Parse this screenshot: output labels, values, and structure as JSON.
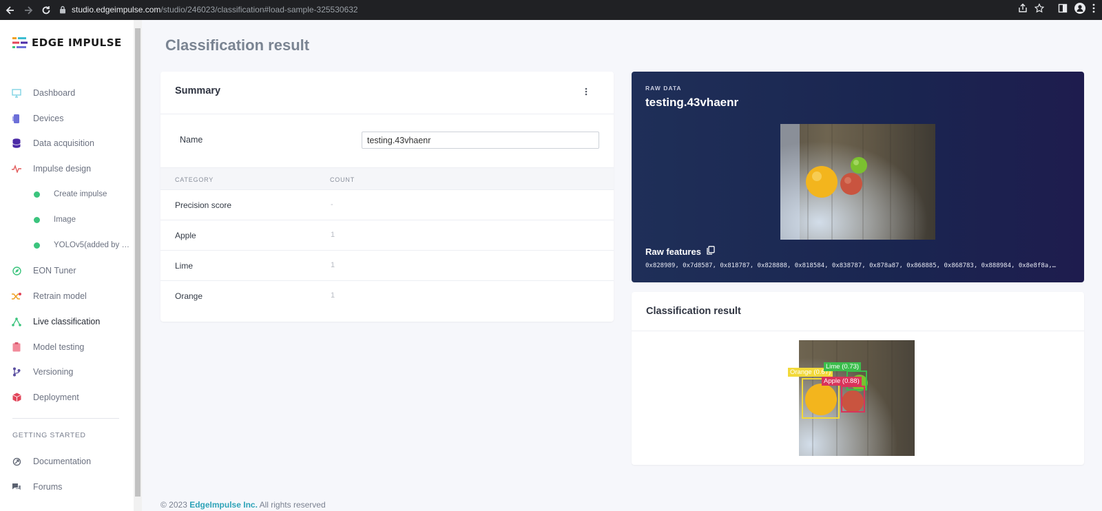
{
  "browser": {
    "url_host": "studio.edgeimpulse.com",
    "url_path": "/studio/246023/classification#load-sample-325530632"
  },
  "sidebar": {
    "logo_text": "EDGE IMPULSE",
    "items": [
      {
        "label": "Dashboard",
        "icon": "monitor-icon",
        "color": "#7fd3e3"
      },
      {
        "label": "Devices",
        "icon": "chip-icon",
        "color": "#6c6fd8"
      },
      {
        "label": "Data acquisition",
        "icon": "database-icon",
        "color": "#4b2aa6"
      },
      {
        "label": "Impulse design",
        "icon": "pulse-icon",
        "color": "#e25b5b"
      },
      {
        "label": "Create impulse",
        "icon": "status-dot-icon",
        "color": "#3bc47d"
      },
      {
        "label": "Image",
        "icon": "status-dot-icon",
        "color": "#3bc47d"
      },
      {
        "label": "YOLOv5(added by S...",
        "icon": "status-dot-icon",
        "color": "#3bc47d"
      },
      {
        "label": "EON Tuner",
        "icon": "compass-icon",
        "color": "#3bc47d"
      },
      {
        "label": "Retrain model",
        "icon": "shuffle-icon",
        "color": "#f0a020"
      },
      {
        "label": "Live classification",
        "icon": "nodes-icon",
        "color": "#3bc47d"
      },
      {
        "label": "Model testing",
        "icon": "clipboard-icon",
        "color": "#f28a9a"
      },
      {
        "label": "Versioning",
        "icon": "branch-icon",
        "color": "#5a4fa0"
      },
      {
        "label": "Deployment",
        "icon": "box-icon",
        "color": "#e2455a"
      }
    ],
    "section_title": "GETTING STARTED",
    "help_items": [
      {
        "label": "Documentation",
        "icon": "docs-icon"
      },
      {
        "label": "Forums",
        "icon": "forum-icon"
      }
    ]
  },
  "main": {
    "page_title": "Classification result",
    "summary": {
      "title": "Summary",
      "name_label": "Name",
      "name_value": "testing.43vhaenr",
      "col_category": "CATEGORY",
      "col_count": "COUNT",
      "rows": [
        {
          "category": "Precision score",
          "count": "-"
        },
        {
          "category": "Apple",
          "count": "1"
        },
        {
          "category": "Lime",
          "count": "1"
        },
        {
          "category": "Orange",
          "count": "1"
        }
      ]
    },
    "raw": {
      "label": "RAW DATA",
      "name": "testing.43vhaenr",
      "features_label": "Raw features",
      "features_values": "0x828989, 0x7d8587, 0x818787, 0x828888, 0x818584, 0x838787, 0x878a87, 0x868885, 0x868783, 0x888984, 0x8e8f8a,…"
    },
    "result": {
      "title": "Classification result",
      "boxes": [
        {
          "label": "Orange (0.67)",
          "color": "#f2d93a"
        },
        {
          "label": "Lime (0.73)",
          "color": "#3bbd4c"
        },
        {
          "label": "Apple (0.88)",
          "color": "#d9335a"
        }
      ]
    }
  },
  "footer": {
    "copyright": "© 2023",
    "company": "EdgeImpulse Inc.",
    "rights": "All rights reserved"
  }
}
